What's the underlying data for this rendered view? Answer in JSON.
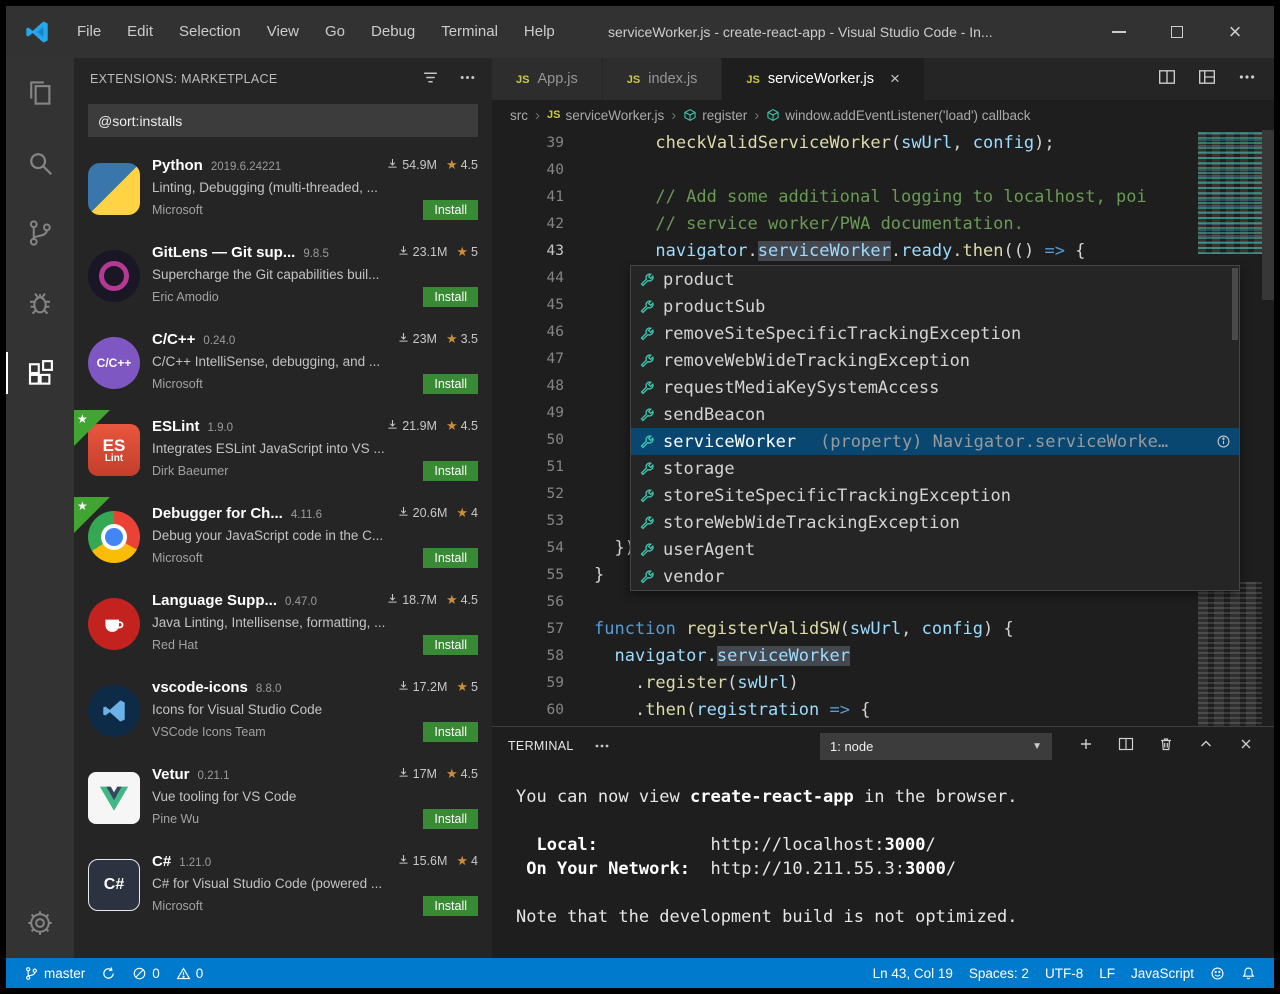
{
  "titlebar": {
    "menus": [
      "File",
      "Edit",
      "Selection",
      "View",
      "Go",
      "Debug",
      "Terminal",
      "Help"
    ],
    "title": "serviceWorker.js - create-react-app - Visual Studio Code - In..."
  },
  "activitybar": {
    "items": [
      {
        "icon": "explorer",
        "active": false
      },
      {
        "icon": "search",
        "active": false
      },
      {
        "icon": "source-control",
        "active": false
      },
      {
        "icon": "debug",
        "active": false
      },
      {
        "icon": "extensions",
        "active": true
      }
    ],
    "bottom": [
      {
        "icon": "settings-gear"
      }
    ]
  },
  "sidebar": {
    "header": "EXTENSIONS: MARKETPLACE",
    "search_value": "@sort:installs",
    "install_label": "Install",
    "extensions": [
      {
        "name": "Python",
        "version": "2019.6.24221",
        "installs": "54.9M",
        "rating": "4.5",
        "description": "Linting, Debugging (multi-threaded, ...",
        "author": "Microsoft",
        "icon": "python",
        "icon_text": "",
        "featured": false
      },
      {
        "name": "GitLens — Git sup...",
        "version": "9.8.5",
        "installs": "23.1M",
        "rating": "5",
        "description": "Supercharge the Git capabilities buil...",
        "author": "Eric Amodio",
        "icon": "gitlens",
        "icon_text": "",
        "featured": false
      },
      {
        "name": "C/C++",
        "version": "0.24.0",
        "installs": "23M",
        "rating": "3.5",
        "description": "C/C++ IntelliSense, debugging, and ...",
        "author": "Microsoft",
        "icon": "cpp",
        "icon_text": "C/C++",
        "featured": false
      },
      {
        "name": "ESLint",
        "version": "1.9.0",
        "installs": "21.9M",
        "rating": "4.5",
        "description": "Integrates ESLint JavaScript into VS ...",
        "author": "Dirk Baeumer",
        "icon": "eslint",
        "icon_text": "ES Lint",
        "featured": true
      },
      {
        "name": "Debugger for Ch...",
        "version": "4.11.6",
        "installs": "20.6M",
        "rating": "4",
        "description": "Debug your JavaScript code in the C...",
        "author": "Microsoft",
        "icon": "chrome",
        "icon_text": "",
        "featured": true
      },
      {
        "name": "Language Supp...",
        "version": "0.47.0",
        "installs": "18.7M",
        "rating": "4.5",
        "description": "Java Linting, Intellisense, formatting, ...",
        "author": "Red Hat",
        "icon": "redhat",
        "icon_text": "",
        "featured": false
      },
      {
        "name": "vscode-icons",
        "version": "8.8.0",
        "installs": "17.2M",
        "rating": "5",
        "description": "Icons for Visual Studio Code",
        "author": "VSCode Icons Team",
        "icon": "vsicons",
        "icon_text": "",
        "featured": false
      },
      {
        "name": "Vetur",
        "version": "0.21.1",
        "installs": "17M",
        "rating": "4.5",
        "description": "Vue tooling for VS Code",
        "author": "Pine Wu",
        "icon": "vetur",
        "icon_text": "",
        "featured": false
      },
      {
        "name": "C#",
        "version": "1.21.0",
        "installs": "15.6M",
        "rating": "4",
        "description": "C# for Visual Studio Code (powered ...",
        "author": "Microsoft",
        "icon": "csharp",
        "icon_text": "C#",
        "featured": false
      }
    ]
  },
  "editor": {
    "tabs": [
      {
        "label": "App.js",
        "icon": "js",
        "active": false,
        "close": ""
      },
      {
        "label": "index.js",
        "icon": "js",
        "active": false,
        "close": ""
      },
      {
        "label": "serviceWorker.js",
        "icon": "js",
        "active": true,
        "close": "×"
      }
    ],
    "breadcrumbs": [
      {
        "label": "src",
        "icon": ""
      },
      {
        "label": "serviceWorker.js",
        "icon": "js"
      },
      {
        "label": "register",
        "icon": "symbol"
      },
      {
        "label": "window.addEventListener('load') callback",
        "icon": "symbol"
      }
    ],
    "code_lines": [
      {
        "num": 39,
        "active": false,
        "segs": [
          {
            "c": "p",
            "t": "      "
          },
          {
            "c": "f",
            "t": "checkValidServiceWorker"
          },
          {
            "c": "p",
            "t": "("
          },
          {
            "c": "v",
            "t": "swUrl"
          },
          {
            "c": "p",
            "t": ", "
          },
          {
            "c": "v",
            "t": "config"
          },
          {
            "c": "p",
            "t": ");"
          }
        ]
      },
      {
        "num": 40,
        "active": false,
        "segs": []
      },
      {
        "num": 41,
        "active": false,
        "segs": [
          {
            "c": "c",
            "t": "      // Add some additional logging to localhost, poi"
          }
        ]
      },
      {
        "num": 42,
        "active": false,
        "segs": [
          {
            "c": "c",
            "t": "      // service worker/PWA documentation."
          }
        ]
      },
      {
        "num": 43,
        "active": true,
        "segs": [
          {
            "c": "p",
            "t": "      "
          },
          {
            "c": "v",
            "t": "navigator"
          },
          {
            "c": "p",
            "t": "."
          },
          {
            "c": "hl",
            "t": "serviceWorker"
          },
          {
            "c": "p",
            "t": "."
          },
          {
            "c": "v",
            "t": "ready"
          },
          {
            "c": "p",
            "t": "."
          },
          {
            "c": "f",
            "t": "then"
          },
          {
            "c": "p",
            "t": "(() "
          },
          {
            "c": "k",
            "t": "=>"
          },
          {
            "c": "p",
            "t": " {"
          }
        ]
      },
      {
        "num": 44,
        "active": false,
        "segs": []
      },
      {
        "num": 45,
        "active": false,
        "segs": []
      },
      {
        "num": 46,
        "active": false,
        "segs": []
      },
      {
        "num": 47,
        "active": false,
        "segs": []
      },
      {
        "num": 48,
        "active": false,
        "segs": []
      },
      {
        "num": 49,
        "active": false,
        "segs": []
      },
      {
        "num": 50,
        "active": false,
        "segs": []
      },
      {
        "num": 51,
        "active": false,
        "segs": []
      },
      {
        "num": 52,
        "active": false,
        "segs": []
      },
      {
        "num": 53,
        "active": false,
        "segs": []
      },
      {
        "num": 54,
        "active": false,
        "segs": [
          {
            "c": "p",
            "t": "  });"
          }
        ]
      },
      {
        "num": 55,
        "active": false,
        "segs": [
          {
            "c": "p",
            "t": "}"
          }
        ]
      },
      {
        "num": 56,
        "active": false,
        "segs": []
      },
      {
        "num": 57,
        "active": false,
        "segs": [
          {
            "c": "k",
            "t": "function"
          },
          {
            "c": "p",
            "t": " "
          },
          {
            "c": "f",
            "t": "registerValidSW"
          },
          {
            "c": "p",
            "t": "("
          },
          {
            "c": "v",
            "t": "swUrl"
          },
          {
            "c": "p",
            "t": ", "
          },
          {
            "c": "v",
            "t": "config"
          },
          {
            "c": "p",
            "t": ") {"
          }
        ]
      },
      {
        "num": 58,
        "active": false,
        "segs": [
          {
            "c": "p",
            "t": "  "
          },
          {
            "c": "v",
            "t": "navigator"
          },
          {
            "c": "p",
            "t": "."
          },
          {
            "c": "hl",
            "t": "serviceWorker"
          }
        ]
      },
      {
        "num": 59,
        "active": false,
        "segs": [
          {
            "c": "p",
            "t": "    ."
          },
          {
            "c": "f",
            "t": "register"
          },
          {
            "c": "p",
            "t": "("
          },
          {
            "c": "v",
            "t": "swUrl"
          },
          {
            "c": "p",
            "t": ")"
          }
        ]
      },
      {
        "num": 60,
        "active": false,
        "segs": [
          {
            "c": "p",
            "t": "    ."
          },
          {
            "c": "f",
            "t": "then"
          },
          {
            "c": "p",
            "t": "("
          },
          {
            "c": "v",
            "t": "registration"
          },
          {
            "c": "p",
            "t": " "
          },
          {
            "c": "k",
            "t": "=>"
          },
          {
            "c": "p",
            "t": " {"
          }
        ]
      }
    ],
    "suggest": {
      "items": [
        {
          "label": "product",
          "selected": false,
          "detail": ""
        },
        {
          "label": "productSub",
          "selected": false,
          "detail": ""
        },
        {
          "label": "removeSiteSpecificTrackingException",
          "selected": false,
          "detail": ""
        },
        {
          "label": "removeWebWideTrackingException",
          "selected": false,
          "detail": ""
        },
        {
          "label": "requestMediaKeySystemAccess",
          "selected": false,
          "detail": ""
        },
        {
          "label": "sendBeacon",
          "selected": false,
          "detail": ""
        },
        {
          "label": "serviceWorker",
          "selected": true,
          "detail": "(property) Navigator.serviceWorke…"
        },
        {
          "label": "storage",
          "selected": false,
          "detail": ""
        },
        {
          "label": "storeSiteSpecificTrackingException",
          "selected": false,
          "detail": ""
        },
        {
          "label": "storeWebWideTrackingException",
          "selected": false,
          "detail": ""
        },
        {
          "label": "userAgent",
          "selected": false,
          "detail": ""
        },
        {
          "label": "vendor",
          "selected": false,
          "detail": ""
        }
      ]
    }
  },
  "terminal": {
    "title": "TERMINAL",
    "dropdown_value": "1: node",
    "lines": [
      [
        {
          "t": "You can now view ",
          "b": false
        },
        {
          "t": "create-react-app",
          "b": true
        },
        {
          "t": " in the browser.",
          "b": false
        }
      ],
      [],
      [
        {
          "t": "  ",
          "b": false
        },
        {
          "t": "Local:",
          "b": true
        },
        {
          "t": "           ",
          "b": false
        },
        {
          "t": "http://localhost:",
          "b": false
        },
        {
          "t": "3000",
          "b": true
        },
        {
          "t": "/",
          "b": false
        }
      ],
      [
        {
          "t": " ",
          "b": false
        },
        {
          "t": "On Your Network:",
          "b": true
        },
        {
          "t": "  ",
          "b": false
        },
        {
          "t": "http://10.211.55.3:",
          "b": false
        },
        {
          "t": "3000",
          "b": true
        },
        {
          "t": "/",
          "b": false
        }
      ],
      [],
      [
        {
          "t": "Note that the development build is not optimized.",
          "b": false
        }
      ]
    ]
  },
  "statusbar": {
    "left": [
      {
        "icon": "git-branch",
        "label": "master"
      },
      {
        "icon": "sync",
        "label": ""
      },
      {
        "icon": "error",
        "label": "0"
      },
      {
        "icon": "warning",
        "label": "0"
      }
    ],
    "right": [
      {
        "icon": "",
        "label": "Ln 43, Col 19"
      },
      {
        "icon": "",
        "label": "Spaces: 2"
      },
      {
        "icon": "",
        "label": "UTF-8"
      },
      {
        "icon": "",
        "label": "LF"
      },
      {
        "icon": "",
        "label": "JavaScript"
      },
      {
        "icon": "smiley",
        "label": ""
      },
      {
        "icon": "bell",
        "label": ""
      }
    ]
  },
  "colors": {
    "statusbar": "#007acc",
    "install_button": "#388a34",
    "suggest_selection": "#094771",
    "symbol_icon": "#3dc9b0"
  }
}
